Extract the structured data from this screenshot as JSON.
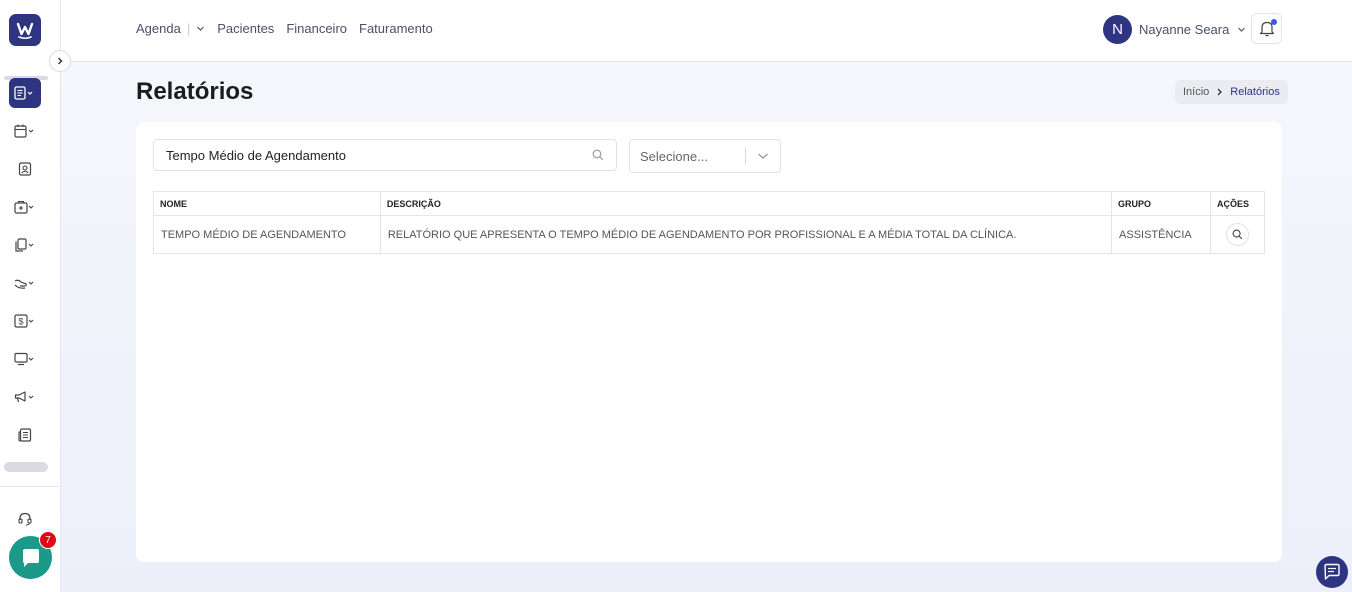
{
  "header": {
    "nav": [
      {
        "label": "Agenda"
      },
      {
        "label": "Pacientes"
      },
      {
        "label": "Financeiro"
      },
      {
        "label": "Faturamento"
      }
    ],
    "user": {
      "initial": "N",
      "name": "Nayanne Seara"
    }
  },
  "page": {
    "title": "Relatórios",
    "breadcrumb": {
      "home": "Início",
      "current": "Relatórios"
    }
  },
  "filters": {
    "search_value": "Tempo Médio de Agendamento",
    "select_placeholder": "Selecione..."
  },
  "table": {
    "columns": [
      "NOME",
      "DESCRIÇÃO",
      "GRUPO",
      "AÇÕES"
    ],
    "rows": [
      {
        "nome": "TEMPO MÉDIO DE AGENDAMENTO",
        "descricao": "RELATÓRIO QUE APRESENTA O TEMPO MÉDIO DE AGENDAMENTO POR PROFISSIONAL E A MÉDIA TOTAL DA CLÍNICA.",
        "grupo": "ASSISTÊNCIA"
      }
    ]
  },
  "chat": {
    "badge": "7"
  },
  "colors": {
    "primary": "#2d3580",
    "chat": "#1b9a8a",
    "badge": "#e30613"
  }
}
